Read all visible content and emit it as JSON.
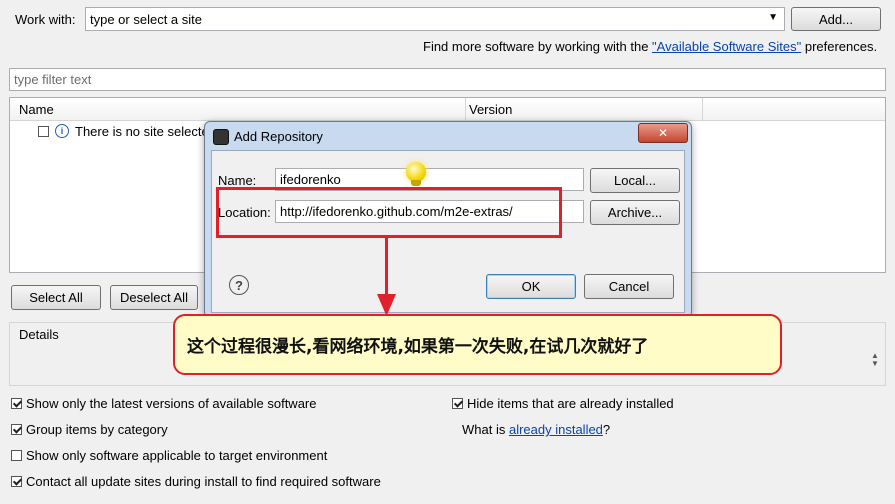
{
  "work_with": {
    "label": "Work with:",
    "value": "type or select a site",
    "add_button": "Add..."
  },
  "find_more": {
    "prefix": "Find more software by working with the ",
    "link": "\"Available Software Sites\"",
    "suffix": " preferences."
  },
  "filter": {
    "placeholder": "type filter text"
  },
  "table": {
    "columns": [
      "Name",
      "Version"
    ],
    "rows": [
      {
        "name": "There is no site selecte",
        "checked": false
      }
    ]
  },
  "buttons": {
    "select_all": "Select All",
    "deselect_all": "Deselect All"
  },
  "details": {
    "label": "Details"
  },
  "options": {
    "latest_versions": {
      "label": "Show only the latest versions of available software",
      "checked": true
    },
    "group_by_category": {
      "label": "Group items by category",
      "checked": true
    },
    "target_env": {
      "label": "Show only software applicable to target environment",
      "checked": false
    },
    "contact_sites": {
      "label": "Contact all update sites during install to find required software",
      "checked": true
    },
    "hide_installed": {
      "label": "Hide items that are already installed",
      "checked": true
    },
    "what_is_prefix": "What is ",
    "what_is_link": "already installed",
    "what_is_suffix": "?"
  },
  "dialog": {
    "title": "Add Repository",
    "name_label": "Name:",
    "name_value": "ifedorenko",
    "location_label": "Location:",
    "location_value": "http://ifedorenko.github.com/m2e-extras/",
    "local_button": "Local...",
    "archive_button": "Archive...",
    "ok_button": "OK",
    "cancel_button": "Cancel",
    "help": "?"
  },
  "callout": {
    "text": "这个过程很漫长,看网络环境,如果第一次失败,在试几次就好了"
  },
  "colors": {
    "accent": "#e0202a",
    "callout_bg": "#fffcc8",
    "link": "#0645ad"
  }
}
